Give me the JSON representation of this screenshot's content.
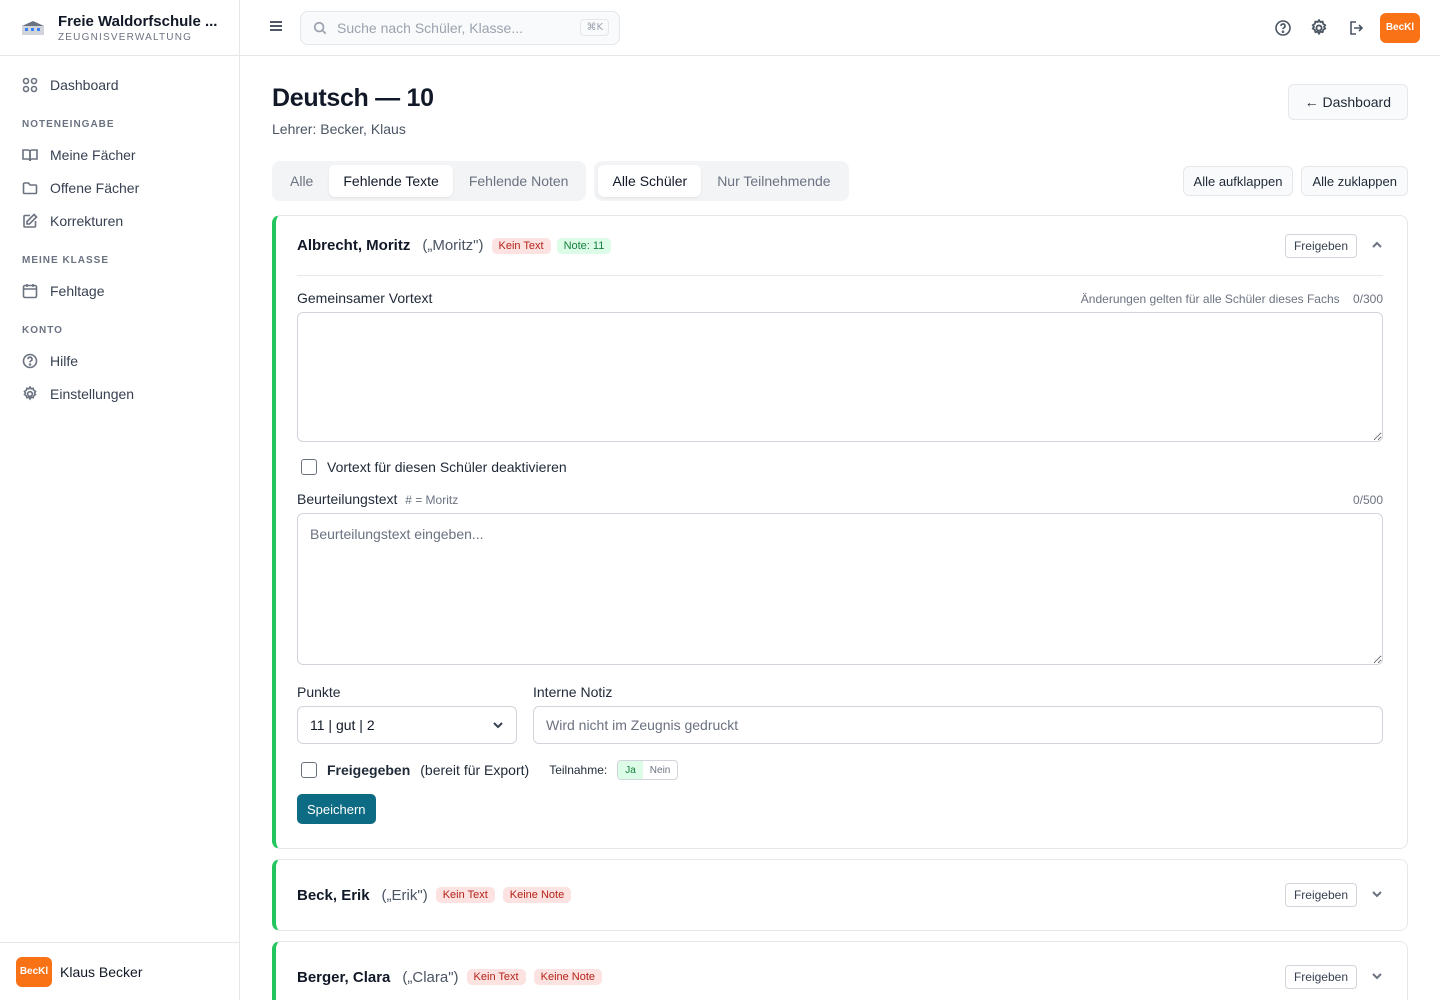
{
  "brand": {
    "name": "Freie Waldorfschule ...",
    "sub": "ZEUGNISVERWALTUNG"
  },
  "sidebar": {
    "dashboard": "Dashboard",
    "section1": "NOTENEINGABE",
    "meine_faecher": "Meine Fächer",
    "offene_faecher": "Offene Fächer",
    "korrekturen": "Korrekturen",
    "section2": "MEINE KLASSE",
    "fehltage": "Fehltage",
    "section3": "KONTO",
    "hilfe": "Hilfe",
    "einstellungen": "Einstellungen",
    "user_badge": "BecKl",
    "user_name": "Klaus Becker"
  },
  "topbar": {
    "search_placeholder": "Suche nach Schüler, Klasse...",
    "shortcut": "⌘K",
    "avatar": "BecKl"
  },
  "page": {
    "title": "Deutsch — 10",
    "subtitle": "Lehrer: Becker, Klaus",
    "back_button": "← Dashboard"
  },
  "filters": {
    "group1": [
      "Alle",
      "Fehlende Texte",
      "Fehlende Noten"
    ],
    "group1_active": "Fehlende Texte",
    "group2": [
      "Alle Schüler",
      "Nur Teilnehmende"
    ],
    "group2_active": "Alle Schüler",
    "expand_all": "Alle aufklappen",
    "collapse_all": "Alle zuklappen"
  },
  "students": [
    {
      "name": "Albrecht, Moritz",
      "nick": "(„Moritz\")",
      "tags": [
        "Kein Text",
        "Note: 11"
      ],
      "expanded": true
    },
    {
      "name": "Beck, Erik",
      "nick": "(„Erik\")",
      "tags": [
        "Kein Text",
        "Keine Note"
      ],
      "expanded": false
    },
    {
      "name": "Berger, Clara",
      "nick": "(„Clara\")",
      "tags": [
        "Kein Text",
        "Keine Note"
      ],
      "expanded": false
    }
  ],
  "editor": {
    "free_button": "Freigeben",
    "vortext_label": "Gemeinsamer Vortext",
    "vortext_hint": "Änderungen gelten für alle Schüler dieses Fachs",
    "vortext_count": "0/300",
    "vortext_disable": "Vortext für diesen Schüler deaktivieren",
    "beurteilung_label": "Beurteilungstext",
    "beurteilung_hint": "# = Moritz",
    "beurteilung_count": "0/500",
    "beurteilung_placeholder": "Beurteilungstext eingeben...",
    "punkte_label": "Punkte",
    "punkte_value": "11 | gut | 2",
    "notiz_label": "Interne Notiz",
    "notiz_placeholder": "Wird nicht im Zeugnis gedruckt",
    "freigegeben": "Freigegeben",
    "freigegeben_hint": "(bereit für Export)",
    "teilnahme": "Teilnahme:",
    "ja": "Ja",
    "nein": "Nein",
    "save": "Speichern"
  },
  "colors": {
    "accent": "#0e6b84",
    "success": "#22c55e",
    "brand_orange": "#f97316"
  }
}
